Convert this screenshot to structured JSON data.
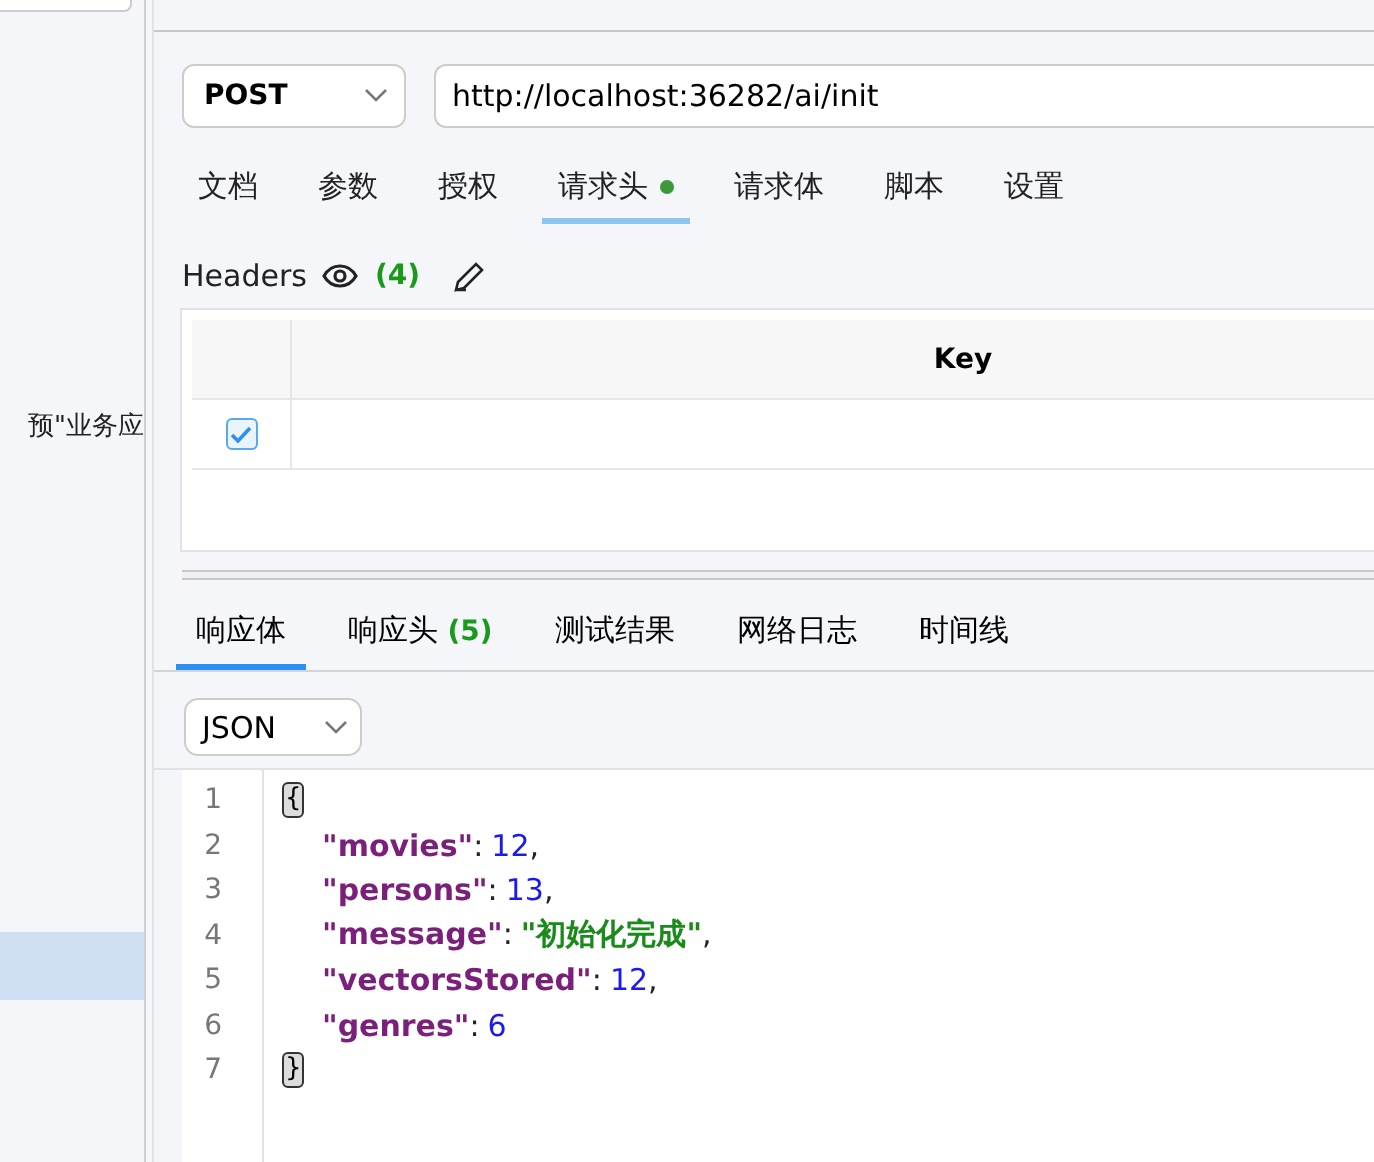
{
  "sidebar": {
    "items": [
      {
        "label": "预\"业务应",
        "selected": false
      },
      {
        "selected": true
      }
    ]
  },
  "request": {
    "method": "POST",
    "url": "http://localhost:36282/ai/init",
    "tabs": [
      {
        "label": "文档",
        "selected": false,
        "dot": false
      },
      {
        "label": "参数",
        "selected": false,
        "dot": false
      },
      {
        "label": "授权",
        "selected": false,
        "dot": false
      },
      {
        "label": "请求头",
        "selected": true,
        "dot": true
      },
      {
        "label": "请求体",
        "selected": false,
        "dot": false
      },
      {
        "label": "脚本",
        "selected": false,
        "dot": false
      },
      {
        "label": "设置",
        "selected": false,
        "dot": false
      }
    ],
    "headers": {
      "title": "Headers",
      "count": "(4)",
      "columns": [
        "Key"
      ],
      "rows": [
        {
          "checked": true
        }
      ]
    }
  },
  "response": {
    "tabs": [
      {
        "label": "响应体",
        "selected": true
      },
      {
        "label": "响应头",
        "count": "(5)",
        "selected": false
      },
      {
        "label": "测试结果",
        "selected": false
      },
      {
        "label": "网络日志",
        "selected": false
      },
      {
        "label": "时间线",
        "selected": false
      }
    ],
    "format": "JSON",
    "lines": [
      {
        "number": "1",
        "tokens": [
          {
            "kind": "brace",
            "text": "{"
          }
        ]
      },
      {
        "number": "2",
        "tokens": [
          {
            "kind": "key",
            "text": "\"movies\""
          },
          {
            "kind": "punct",
            "text": ":"
          },
          {
            "kind": "number",
            "text": "12"
          },
          {
            "kind": "punct",
            "text": ","
          }
        ]
      },
      {
        "number": "3",
        "tokens": [
          {
            "kind": "key",
            "text": "\"persons\""
          },
          {
            "kind": "punct",
            "text": ":"
          },
          {
            "kind": "number",
            "text": "13"
          },
          {
            "kind": "punct",
            "text": ","
          }
        ]
      },
      {
        "number": "4",
        "tokens": [
          {
            "kind": "key",
            "text": "\"message\""
          },
          {
            "kind": "punct",
            "text": ":"
          },
          {
            "kind": "string",
            "text": "\"初始化完成\""
          },
          {
            "kind": "punct",
            "text": ","
          }
        ]
      },
      {
        "number": "5",
        "tokens": [
          {
            "kind": "key",
            "text": "\"vectorsStored\""
          },
          {
            "kind": "punct",
            "text": ":"
          },
          {
            "kind": "number",
            "text": "12"
          },
          {
            "kind": "punct",
            "text": ","
          }
        ]
      },
      {
        "number": "6",
        "tokens": [
          {
            "kind": "key",
            "text": "\"genres\""
          },
          {
            "kind": "punct",
            "text": ":"
          },
          {
            "kind": "number",
            "text": "6"
          }
        ]
      },
      {
        "number": "7",
        "tokens": [
          {
            "kind": "brace",
            "text": "}"
          }
        ]
      }
    ]
  }
}
